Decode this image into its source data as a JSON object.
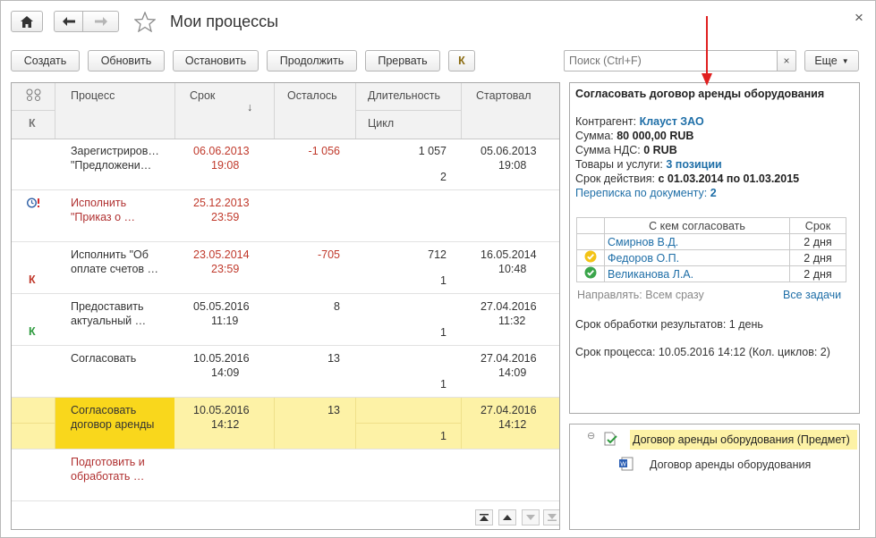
{
  "window": {
    "title": "Мои процессы",
    "close_glyph": "×"
  },
  "toolbar": {
    "create": "Создать",
    "refresh": "Обновить",
    "stop": "Остановить",
    "continue": "Продолжить",
    "abort": "Прервать",
    "k_label": "К",
    "search_placeholder": "Поиск (Ctrl+F)",
    "clear_glyph": "×",
    "more": "Еще"
  },
  "grid": {
    "headers": {
      "k": "К",
      "process": "Процесс",
      "deadline": "Срок",
      "sort_arrow": "↓",
      "remaining": "Осталось",
      "duration": "Длительность",
      "cycle": "Цикл",
      "started": "Стартовал"
    },
    "rows": [
      {
        "mark": "",
        "process1": "Зарегистриров…",
        "process2": "\"Предложени…",
        "deadline1": "06.06.2013",
        "deadline2": "19:08",
        "remaining": "-1 056",
        "duration": "1 057",
        "cycle": "2",
        "start1": "05.06.2013",
        "start2": "19:08"
      },
      {
        "mark": "",
        "process1": "Исполнить",
        "process2": "\"Приказ о …",
        "deadline1": "25.12.2013",
        "deadline2": "23:59",
        "remaining": "",
        "duration": "",
        "cycle": "",
        "start1": "",
        "start2": ""
      },
      {
        "mark": "К",
        "process1": "Исполнить \"Об",
        "process2": "оплате счетов …",
        "deadline1": "23.05.2014",
        "deadline2": "23:59",
        "remaining": "-705",
        "duration": "712",
        "cycle": "1",
        "start1": "16.05.2014",
        "start2": "10:48"
      },
      {
        "mark": "К",
        "process1": "Предоставить",
        "process2": "актуальный …",
        "deadline1": "05.05.2016",
        "deadline2": "11:19",
        "remaining": "8",
        "duration": "",
        "cycle": "1",
        "start1": "27.04.2016",
        "start2": "11:32"
      },
      {
        "mark": "",
        "process1": "Согласовать",
        "process2": "",
        "deadline1": "10.05.2016",
        "deadline2": "14:09",
        "remaining": "13",
        "duration": "",
        "cycle": "1",
        "start1": "27.04.2016",
        "start2": "14:09"
      },
      {
        "mark": "",
        "process1": "Согласовать",
        "process2": "договор аренды",
        "deadline1": "10.05.2016",
        "deadline2": "14:12",
        "remaining": "13",
        "duration": "",
        "cycle": "1",
        "start1": "27.04.2016",
        "start2": "14:12"
      },
      {
        "mark": "",
        "process1": "Подготовить и",
        "process2": "обработать …",
        "deadline1": "",
        "deadline2": "",
        "remaining": "",
        "duration": "",
        "cycle": "",
        "start1": "",
        "start2": ""
      }
    ]
  },
  "details": {
    "title": "Согласовать договор аренды оборудования",
    "counterparty_label": "Контрагент:",
    "counterparty": "Клауст ЗАО",
    "sum_label": "Сумма:",
    "sum": "80 000,00 RUB",
    "vat_label": "Сумма НДС:",
    "vat": "0 RUB",
    "goods_label": "Товары и услуги:",
    "goods": "3 позиции",
    "term_label": "Срок действия:",
    "term": "с 01.03.2014 по 01.03.2015",
    "correspondence_label": "Переписка по документу:",
    "correspondence": "2",
    "approvers_header": "С кем согласовать",
    "term_header": "Срок",
    "approvers": [
      {
        "name": "Смирнов В.Д.",
        "term": "2 дня",
        "status": ""
      },
      {
        "name": "Федоров О.П.",
        "term": "2 дня",
        "status": "pending"
      },
      {
        "name": "Великанова Л.А.",
        "term": "2 дня",
        "status": "approved"
      }
    ],
    "direction": "Направлять: Всем сразу",
    "all_tasks": "Все задачи",
    "result_processing": "Срок обработки результатов: 1 день",
    "process_deadline": "Срок процесса: 10.05.2016 14:12 (Кол. циклов: 2)"
  },
  "subjects": {
    "root": "Договор аренды оборудования (Предмет)",
    "child": "Договор аренды оборудования"
  },
  "colors": {
    "accent_red": "#c0392b",
    "link": "#1e6ea7",
    "selected_row": "#fdf2a6",
    "selected_cell": "#f9d71c"
  }
}
